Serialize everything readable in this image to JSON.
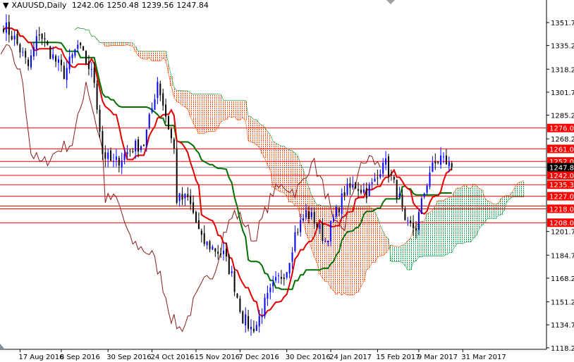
{
  "header": {
    "symbol": "XAUUSD,Daily",
    "open": "1242.06",
    "high": "1250.48",
    "low": "1239.56",
    "close": "1247.84"
  },
  "colors": {
    "bull": "#0000ff",
    "bear": "#000000",
    "tenkan": "#e00000",
    "kijun": "#007000",
    "chikou": "#8b1a1a",
    "cloud_bear": "#ff4500",
    "cloud_bull": "#00a040",
    "level_line": "#ff0000",
    "level_label_bg": "#ff0000",
    "current_label_bg": "#000000"
  },
  "chart_data": {
    "type": "candlestick",
    "title": "XAUUSD,Daily",
    "indicator": "Ichimoku Kinko Hyo (9,26,52)",
    "ylim": [
      1118.2,
      1360
    ],
    "y_ticks": [
      "1351.70",
      "1335.20",
      "1318.20",
      "1301.70",
      "1285.20",
      "1268.20",
      "1201.70",
      "1184.70",
      "1168.20",
      "1151.20",
      "1134.70",
      "1118.20"
    ],
    "x_ticks": [
      {
        "bar": 6,
        "label": "17 Aug 2016"
      },
      {
        "bar": 21,
        "label": "8 Sep 2016"
      },
      {
        "bar": 38,
        "label": "30 Sep 2016"
      },
      {
        "bar": 54,
        "label": "24 Oct 2016"
      },
      {
        "bar": 70,
        "label": "15 Nov 2016"
      },
      {
        "bar": 86,
        "label": "7 Dec 2016"
      },
      {
        "bar": 103,
        "label": "30 Dec 2016"
      },
      {
        "bar": 119,
        "label": "24 Jan 2017"
      },
      {
        "bar": 136,
        "label": "15 Feb 2017"
      },
      {
        "bar": 151,
        "label": "9 Mar 2017"
      },
      {
        "bar": 167,
        "label": "31 Mar 2017"
      }
    ],
    "close_keyframes": [
      [
        0,
        1350
      ],
      [
        4,
        1340
      ],
      [
        9,
        1320
      ],
      [
        13,
        1345
      ],
      [
        17,
        1330
      ],
      [
        22,
        1315
      ],
      [
        27,
        1335
      ],
      [
        31,
        1320
      ],
      [
        33,
        1310
      ],
      [
        36,
        1258
      ],
      [
        40,
        1250
      ],
      [
        43,
        1255
      ],
      [
        47,
        1262
      ],
      [
        51,
        1265
      ],
      [
        54,
        1290
      ],
      [
        56,
        1310
      ],
      [
        59,
        1285
      ],
      [
        62,
        1260
      ],
      [
        63,
        1225
      ],
      [
        67,
        1225
      ],
      [
        69,
        1215
      ],
      [
        72,
        1195
      ],
      [
        76,
        1190
      ],
      [
        80,
        1185
      ],
      [
        83,
        1170
      ],
      [
        87,
        1140
      ],
      [
        90,
        1132
      ],
      [
        92,
        1135
      ],
      [
        95,
        1150
      ],
      [
        99,
        1165
      ],
      [
        103,
        1175
      ],
      [
        106,
        1200
      ],
      [
        110,
        1215
      ],
      [
        113,
        1210
      ],
      [
        117,
        1195
      ],
      [
        120,
        1210
      ],
      [
        124,
        1230
      ],
      [
        128,
        1235
      ],
      [
        132,
        1230
      ],
      [
        136,
        1240
      ],
      [
        138,
        1255
      ],
      [
        141,
        1240
      ],
      [
        144,
        1225
      ],
      [
        146,
        1205
      ],
      [
        150,
        1205
      ],
      [
        153,
        1230
      ],
      [
        155,
        1245
      ],
      [
        159,
        1255
      ],
      [
        163,
        1247.84
      ]
    ],
    "levels": [
      {
        "price": 1276.0,
        "label": "1276.00"
      },
      {
        "price": 1261.0,
        "label": "1261.00"
      },
      {
        "price": 1252.0,
        "label": "1252.00"
      },
      {
        "price": 1242.0,
        "label": "1242.00"
      },
      {
        "price": 1235.3,
        "label": "1235.30"
      },
      {
        "price": 1227.0,
        "label": "1227.00"
      },
      {
        "price": 1220.0,
        "label": ""
      },
      {
        "price": 1218.0,
        "label": "1218.00"
      },
      {
        "price": 1208.0,
        "label": "1208.00"
      }
    ],
    "current_price": {
      "price": 1247.84,
      "label": "1247.84"
    }
  }
}
